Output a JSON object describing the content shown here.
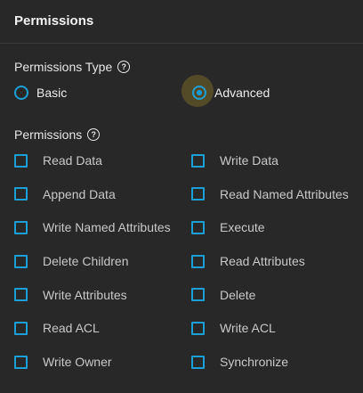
{
  "title": "Permissions",
  "permissions_type": {
    "label": "Permissions Type",
    "options": [
      {
        "label": "Basic",
        "checked": false
      },
      {
        "label": "Advanced",
        "checked": true
      }
    ]
  },
  "permissions": {
    "label": "Permissions",
    "rows": [
      [
        {
          "label": "Read Data",
          "checked": false
        },
        {
          "label": "Write Data",
          "checked": false
        }
      ],
      [
        {
          "label": "Append Data",
          "checked": false
        },
        {
          "label": "Read Named Attributes",
          "checked": false
        }
      ],
      [
        {
          "label": "Write Named Attributes",
          "checked": false
        },
        {
          "label": "Execute",
          "checked": false
        }
      ],
      [
        {
          "label": "Delete Children",
          "checked": false
        },
        {
          "label": "Read Attributes",
          "checked": false
        }
      ],
      [
        {
          "label": "Write Attributes",
          "checked": false
        },
        {
          "label": "Delete",
          "checked": false
        }
      ],
      [
        {
          "label": "Read ACL",
          "checked": false
        },
        {
          "label": "Write ACL",
          "checked": false
        }
      ],
      [
        {
          "label": "Write Owner",
          "checked": false
        },
        {
          "label": "Synchronize",
          "checked": false
        }
      ]
    ]
  },
  "icons": {
    "help": "question-mark-circle-icon"
  },
  "colors": {
    "background": "#282828",
    "accent": "#1c9fd6",
    "focus_halo": "#a48c28"
  }
}
